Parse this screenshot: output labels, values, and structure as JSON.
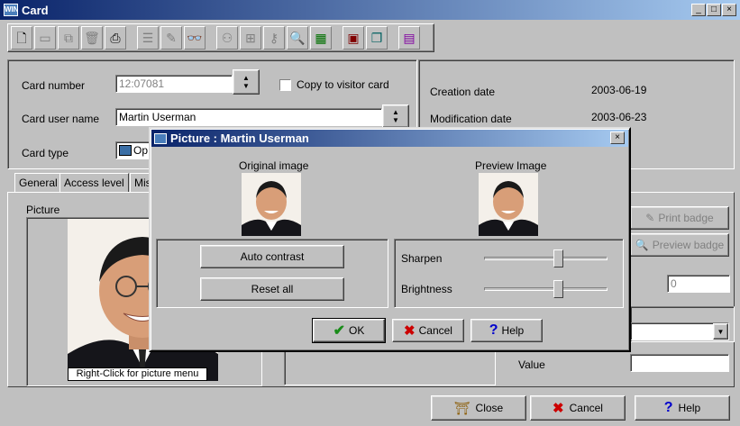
{
  "window": {
    "title": "Card",
    "app_icon_text": "WIN"
  },
  "form": {
    "card_number_label": "Card number",
    "card_number_value": "12:07081",
    "copy_to_visitor_label": "Copy to visitor card",
    "card_user_name_label": "Card user name",
    "card_user_name_value": "Martin Userman",
    "card_type_label": "Card type",
    "card_type_value": "Op",
    "creation_date_label": "Creation date",
    "creation_date_value": "2003-06-19",
    "modification_date_label": "Modification date",
    "modification_date_value": "2003-06-23"
  },
  "tabs": [
    "General",
    "Access level",
    "Mis"
  ],
  "picture": {
    "label": "Picture",
    "context_hint": "Right-Click for picture menu"
  },
  "side_buttons": {
    "print_badge": "Print badge",
    "preview_badge": "Preview badge"
  },
  "right_panel": {
    "number_value": "0",
    "value_label": "Value"
  },
  "bottom_buttons": {
    "close": "Close",
    "cancel": "Cancel",
    "help": "Help"
  },
  "dialog": {
    "title": "Picture : Martin Userman",
    "original_label": "Original image",
    "preview_label": "Preview Image",
    "auto_contrast": "Auto contrast",
    "reset_all": "Reset all",
    "sharpen_label": "Sharpen",
    "brightness_label": "Brightness",
    "sharpen_level": 0.6,
    "brightness_level": 0.6,
    "ok": "OK",
    "cancel": "Cancel",
    "help": "Help"
  },
  "colors": {
    "title_bar": "#0a246a",
    "check_green": "#1a8c1a",
    "cancel_red": "#cc0000",
    "help_blue": "#0000cc"
  }
}
